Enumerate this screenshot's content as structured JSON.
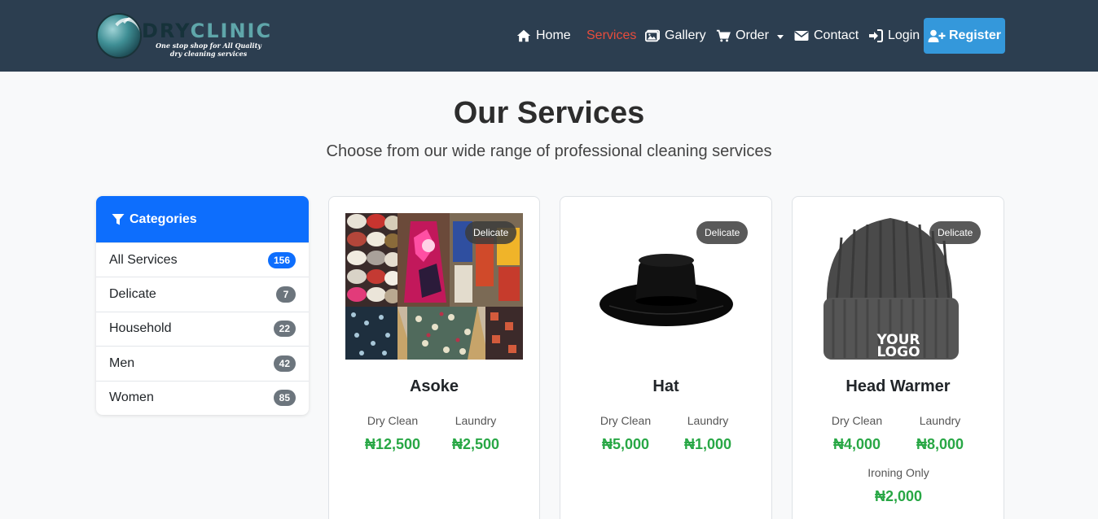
{
  "brand": {
    "name_part1": "DRY",
    "name_part2": "CLINIC",
    "tagline_line1": "One stop shop for All Quality",
    "tagline_line2": "dry cleaning services"
  },
  "nav": {
    "home": "Home",
    "services": "Services",
    "gallery": "Gallery",
    "order": "Order",
    "contact": "Contact",
    "login": "Login",
    "register": "Register"
  },
  "colors": {
    "navbar": "#2c3e50",
    "active_nav": "#e74c3c",
    "register_button": "#3498db",
    "categories_header": "#0d6efd",
    "price": "#28a745"
  },
  "page": {
    "title": "Our Services",
    "subtitle": "Choose from our wide range of professional cleaning services"
  },
  "categories": {
    "header": "Categories",
    "items": [
      {
        "label": "All Services",
        "count": "156"
      },
      {
        "label": "Delicate",
        "count": "7"
      },
      {
        "label": "Household",
        "count": "22"
      },
      {
        "label": "Men",
        "count": "42"
      },
      {
        "label": "Women",
        "count": "85"
      }
    ]
  },
  "services": [
    {
      "name": "Asoke",
      "badge": "Delicate",
      "image": "fabric-photo",
      "prices": [
        {
          "label": "Dry Clean",
          "value": "₦12,500"
        },
        {
          "label": "Laundry",
          "value": "₦2,500"
        }
      ]
    },
    {
      "name": "Hat",
      "badge": "Delicate",
      "image": "black-hat",
      "prices": [
        {
          "label": "Dry Clean",
          "value": "₦5,000"
        },
        {
          "label": "Laundry",
          "value": "₦1,000"
        }
      ]
    },
    {
      "name": "Head Warmer",
      "badge": "Delicate",
      "image": "beanie",
      "image_text_line1": "YOUR",
      "image_text_line2": "LOGO",
      "prices": [
        {
          "label": "Dry Clean",
          "value": "₦4,000"
        },
        {
          "label": "Laundry",
          "value": "₦8,000"
        },
        {
          "label": "Ironing Only",
          "value": "₦2,000"
        }
      ]
    }
  ]
}
